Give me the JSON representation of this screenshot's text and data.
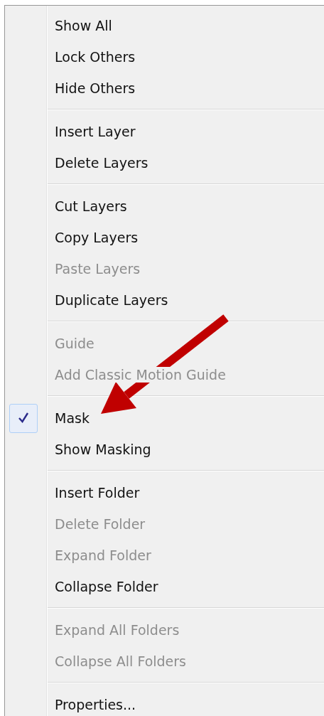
{
  "menu": {
    "groups": [
      {
        "items": [
          {
            "label": "Show All",
            "disabled": false,
            "checked": false
          },
          {
            "label": "Lock Others",
            "disabled": false,
            "checked": false
          },
          {
            "label": "Hide Others",
            "disabled": false,
            "checked": false
          }
        ]
      },
      {
        "items": [
          {
            "label": "Insert Layer",
            "disabled": false,
            "checked": false
          },
          {
            "label": "Delete Layers",
            "disabled": false,
            "checked": false
          }
        ]
      },
      {
        "items": [
          {
            "label": "Cut Layers",
            "disabled": false,
            "checked": false
          },
          {
            "label": "Copy Layers",
            "disabled": false,
            "checked": false
          },
          {
            "label": "Paste Layers",
            "disabled": true,
            "checked": false
          },
          {
            "label": "Duplicate Layers",
            "disabled": false,
            "checked": false
          }
        ]
      },
      {
        "items": [
          {
            "label": "Guide",
            "disabled": true,
            "checked": false
          },
          {
            "label": "Add Classic Motion Guide",
            "disabled": true,
            "checked": false
          }
        ]
      },
      {
        "items": [
          {
            "label": "Mask",
            "disabled": false,
            "checked": true
          },
          {
            "label": "Show Masking",
            "disabled": false,
            "checked": false
          }
        ]
      },
      {
        "items": [
          {
            "label": "Insert Folder",
            "disabled": false,
            "checked": false
          },
          {
            "label": "Delete Folder",
            "disabled": true,
            "checked": false
          },
          {
            "label": "Expand Folder",
            "disabled": true,
            "checked": false
          },
          {
            "label": "Collapse Folder",
            "disabled": false,
            "checked": false
          }
        ]
      },
      {
        "items": [
          {
            "label": "Expand All Folders",
            "disabled": true,
            "checked": false
          },
          {
            "label": "Collapse All Folders",
            "disabled": true,
            "checked": false
          }
        ]
      },
      {
        "items": [
          {
            "label": "Properties...",
            "disabled": false,
            "checked": false
          }
        ]
      }
    ]
  }
}
